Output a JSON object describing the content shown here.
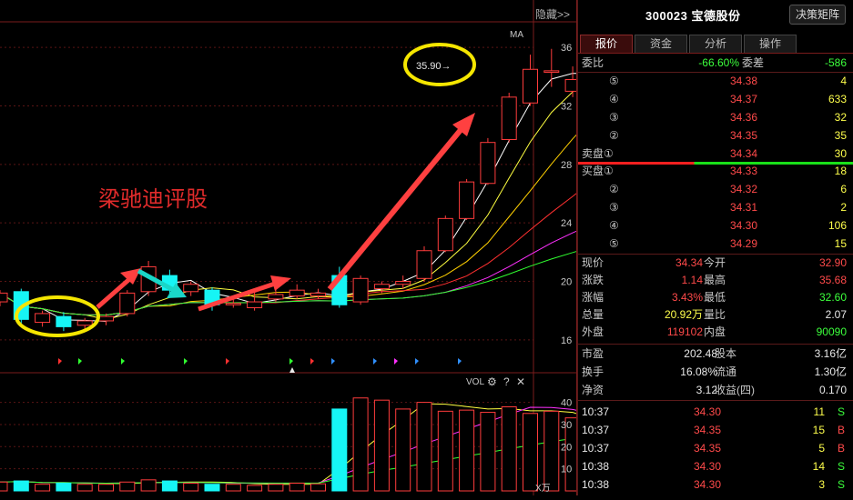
{
  "chart": {
    "hide_label": "隐藏>>",
    "ma_label": "MA",
    "price_label_box": "35.90→",
    "watermark": "梁驰迪评股",
    "price_axis": [
      "36",
      "32",
      "28",
      "24",
      "20",
      "16"
    ],
    "vol_label": "VOL",
    "vol_axis": [
      "40",
      "30",
      "20",
      "10"
    ],
    "vol_unit": "X万",
    "settings_icon": "gear-icon",
    "help_icon": "question-icon",
    "close_icon": "close-icon"
  },
  "chart_data": {
    "type": "candlestick",
    "candles": [
      {
        "o": 18.6,
        "c": 19.2,
        "h": 19.4,
        "l": 18.3
      },
      {
        "o": 19.3,
        "c": 17.4,
        "h": 19.5,
        "l": 17.0
      },
      {
        "o": 17.2,
        "c": 17.8,
        "h": 18.0,
        "l": 16.9
      },
      {
        "o": 17.6,
        "c": 16.9,
        "h": 17.9,
        "l": 16.6
      },
      {
        "o": 17.0,
        "c": 17.3,
        "h": 17.5,
        "l": 16.6
      },
      {
        "o": 17.3,
        "c": 17.6,
        "h": 17.8,
        "l": 17.0
      },
      {
        "o": 17.8,
        "c": 19.2,
        "h": 19.4,
        "l": 17.6
      },
      {
        "o": 19.3,
        "c": 21.0,
        "h": 21.4,
        "l": 19.0
      },
      {
        "o": 20.4,
        "c": 19.4,
        "h": 20.8,
        "l": 19.0
      },
      {
        "o": 19.3,
        "c": 19.8,
        "h": 20.0,
        "l": 19.0
      },
      {
        "o": 19.4,
        "c": 18.4,
        "h": 19.6,
        "l": 18.0
      },
      {
        "o": 18.4,
        "c": 18.5,
        "h": 18.8,
        "l": 18.2
      },
      {
        "o": 18.2,
        "c": 18.6,
        "h": 19.4,
        "l": 18.0
      },
      {
        "o": 18.8,
        "c": 19.1,
        "h": 19.5,
        "l": 18.6
      },
      {
        "o": 19.0,
        "c": 19.4,
        "h": 19.8,
        "l": 18.8
      },
      {
        "o": 19.0,
        "c": 19.2,
        "h": 19.5,
        "l": 18.8
      },
      {
        "o": 20.4,
        "c": 18.4,
        "h": 21.0,
        "l": 18.2
      },
      {
        "o": 18.6,
        "c": 20.2,
        "h": 20.4,
        "l": 18.4
      },
      {
        "o": 19.5,
        "c": 19.8,
        "h": 20.0,
        "l": 19.2
      },
      {
        "o": 19.8,
        "c": 20.0,
        "h": 20.4,
        "l": 19.5
      },
      {
        "o": 20.2,
        "c": 22.1,
        "h": 22.4,
        "l": 20.0
      },
      {
        "o": 22.1,
        "c": 24.3,
        "h": 24.5,
        "l": 22.0
      },
      {
        "o": 24.3,
        "c": 26.8,
        "h": 27.0,
        "l": 24.2
      },
      {
        "o": 26.7,
        "c": 29.5,
        "h": 29.8,
        "l": 26.6
      },
      {
        "o": 29.7,
        "c": 32.6,
        "h": 32.9,
        "l": 29.5
      },
      {
        "o": 32.2,
        "c": 34.5,
        "h": 35.5,
        "l": 32.0
      },
      {
        "o": 34.3,
        "c": 34.4,
        "h": 35.9,
        "l": 33.3
      },
      {
        "o": 33.0,
        "c": 33.8,
        "h": 34.7,
        "l": 32.6
      },
      {
        "o": 32.9,
        "c": 34.34,
        "h": 35.68,
        "l": 32.6
      }
    ],
    "volumes": [
      4,
      4.5,
      3,
      3.5,
      3,
      3,
      4,
      5,
      4.5,
      3.5,
      3,
      3,
      2.5,
      3,
      3.5,
      3.2,
      37,
      42,
      41,
      37,
      40,
      36,
      36.5,
      35.5,
      38,
      35,
      36,
      33,
      20
    ],
    "price_range": [
      14.5,
      37.5
    ],
    "vol_range": [
      0,
      46
    ]
  },
  "quote": {
    "code_name": "300023 宝德股份",
    "matrix_button": "决策矩阵",
    "tabs": [
      "报价",
      "资金",
      "分析",
      "操作"
    ],
    "ratio_label": "委比",
    "ratio_value": "-66.60%",
    "diff_label": "委差",
    "diff_value": "-586",
    "sells": [
      {
        "label": "⑤",
        "price": "34.38",
        "vol": "4"
      },
      {
        "label": "④",
        "price": "34.37",
        "vol": "633"
      },
      {
        "label": "③",
        "price": "34.36",
        "vol": "32"
      },
      {
        "label": "②",
        "price": "34.35",
        "vol": "35"
      },
      {
        "label": "卖盘①",
        "price": "34.34",
        "vol": "30"
      }
    ],
    "buys": [
      {
        "label": "买盘①",
        "price": "34.33",
        "vol": "18"
      },
      {
        "label": "②",
        "price": "34.32",
        "vol": "6"
      },
      {
        "label": "③",
        "price": "34.31",
        "vol": "2"
      },
      {
        "label": "④",
        "price": "34.30",
        "vol": "106"
      },
      {
        "label": "⑤",
        "price": "34.29",
        "vol": "15"
      }
    ],
    "stats": [
      {
        "l1": "现价",
        "v1": "34.34",
        "c1": "red",
        "l2": "今开",
        "v2": "32.90",
        "c2": "red"
      },
      {
        "l1": "涨跌",
        "v1": "1.14",
        "c1": "red",
        "l2": "最高",
        "v2": "35.68",
        "c2": "red"
      },
      {
        "l1": "涨幅",
        "v1": "3.43%",
        "c1": "red",
        "l2": "最低",
        "v2": "32.60",
        "c2": "green"
      },
      {
        "l1": "总量",
        "v1": "20.92万",
        "c1": "yellow",
        "l2": "量比",
        "v2": "2.07",
        "c2": "white"
      },
      {
        "l1": "外盘",
        "v1": "119102",
        "c1": "red",
        "l2": "内盘",
        "v2": "90090",
        "c2": "green"
      }
    ],
    "fund": [
      {
        "l1": "市盈",
        "v1": "202.48",
        "l2": "股本",
        "v2": "3.16亿"
      },
      {
        "l1": "换手",
        "v1": "16.08%",
        "l2": "流通",
        "v2": "1.30亿"
      },
      {
        "l1": "净资",
        "v1": "3.12",
        "l2": "收益(四)",
        "v2": "0.170"
      }
    ],
    "ticks": [
      {
        "time": "10:37",
        "price": "34.30",
        "vol": "11",
        "side": "S"
      },
      {
        "time": "10:37",
        "price": "34.35",
        "vol": "15",
        "side": "B"
      },
      {
        "time": "10:37",
        "price": "34.35",
        "vol": "5",
        "side": "B"
      },
      {
        "time": "10:38",
        "price": "34.30",
        "vol": "14",
        "side": "S"
      },
      {
        "time": "10:38",
        "price": "34.30",
        "vol": "3",
        "side": "S"
      }
    ]
  }
}
